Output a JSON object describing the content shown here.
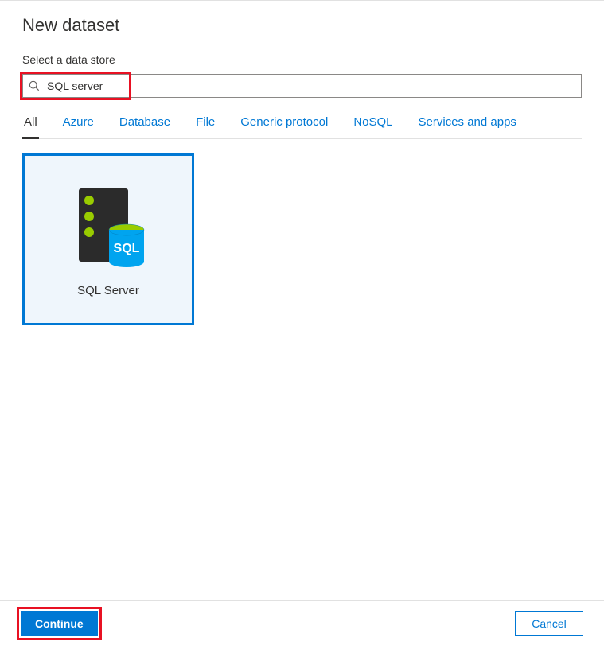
{
  "header": {
    "title": "New dataset",
    "subtitle": "Select a data store"
  },
  "search": {
    "value": "SQL server"
  },
  "tabs": [
    {
      "label": "All",
      "active": true
    },
    {
      "label": "Azure",
      "active": false
    },
    {
      "label": "Database",
      "active": false
    },
    {
      "label": "File",
      "active": false
    },
    {
      "label": "Generic protocol",
      "active": false
    },
    {
      "label": "NoSQL",
      "active": false
    },
    {
      "label": "Services and apps",
      "active": false
    }
  ],
  "results": [
    {
      "label": "SQL Server",
      "icon": "sql-server-icon",
      "selected": true
    }
  ],
  "footer": {
    "continue_label": "Continue",
    "cancel_label": "Cancel"
  },
  "colors": {
    "accent": "#0078d4",
    "highlight": "#e81123",
    "selected_bg": "#eff6fc"
  }
}
